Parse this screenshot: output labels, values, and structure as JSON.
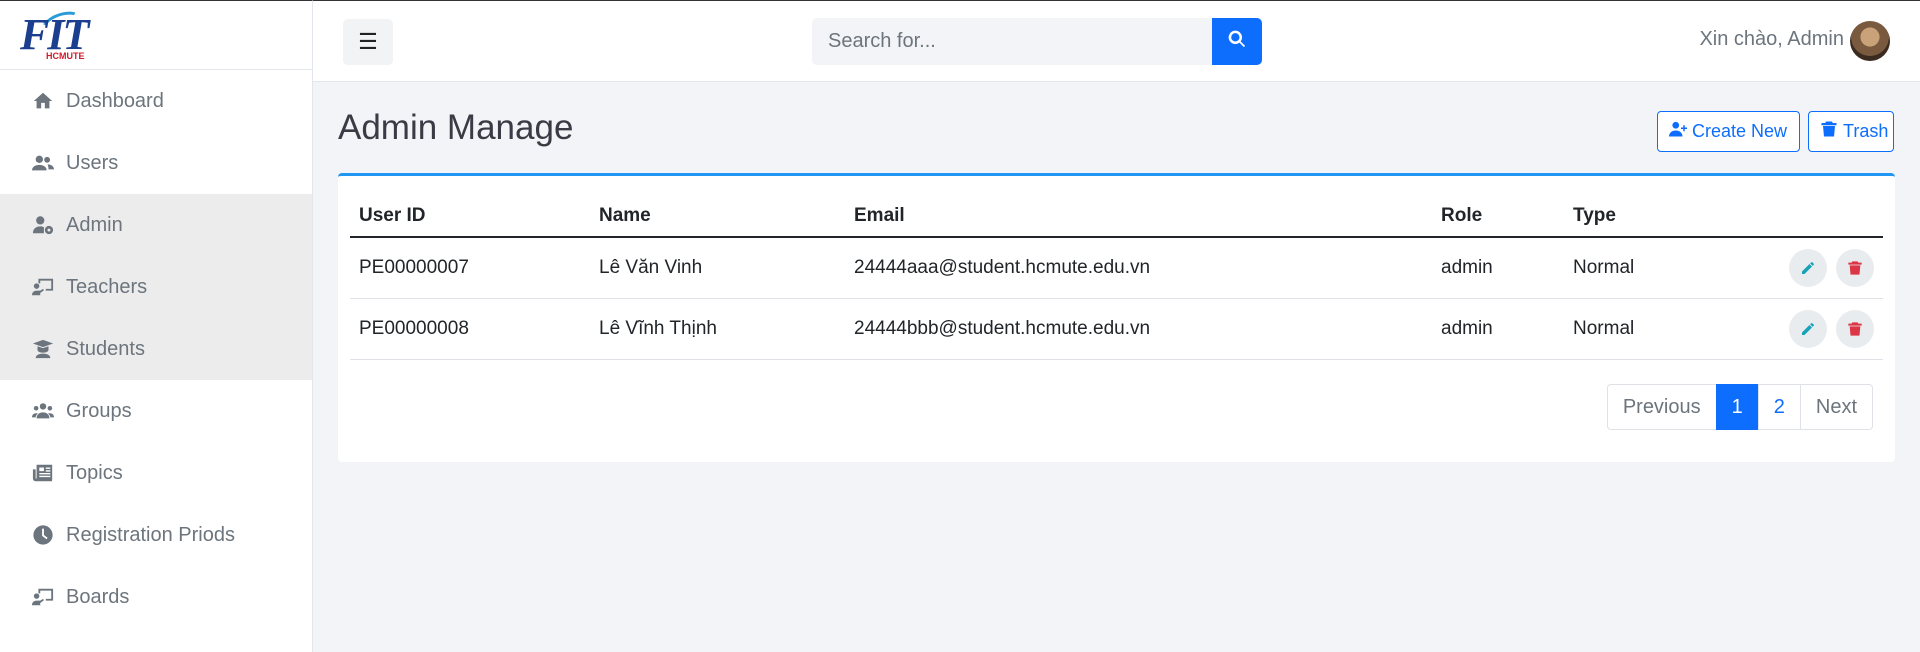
{
  "logo": {
    "text": "FIT",
    "sub": "HCMUTE"
  },
  "sidebar": {
    "items": [
      {
        "label": "Dashboard",
        "icon": "home-icon"
      },
      {
        "label": "Users",
        "icon": "users-icon"
      },
      {
        "label": "Admin",
        "icon": "user-gear-icon",
        "active": true
      },
      {
        "label": "Teachers",
        "icon": "chalkboard-teacher-icon",
        "active": true
      },
      {
        "label": "Students",
        "icon": "graduate-icon",
        "active": true
      },
      {
        "label": "Groups",
        "icon": "group-icon"
      },
      {
        "label": "Topics",
        "icon": "newspaper-icon"
      },
      {
        "label": "Registration Priods",
        "icon": "clock-icon"
      },
      {
        "label": "Boards",
        "icon": "chalkboard-icon"
      }
    ]
  },
  "topbar": {
    "search_placeholder": "Search for...",
    "greeting": "Xin chào, Admin"
  },
  "main": {
    "title": "Admin Manage",
    "create_label": "Create New",
    "trash_label": "Trash",
    "table": {
      "headers": [
        "User ID",
        "Name",
        "Email",
        "Role",
        "Type"
      ],
      "rows": [
        {
          "id": "PE00000007",
          "name": "Lê Văn Vinh",
          "email": "24444aaa@student.hcmute.edu.vn",
          "role": "admin",
          "type": "Normal"
        },
        {
          "id": "PE00000008",
          "name": "Lê Vĩnh Thịnh",
          "email": "24444bbb@student.hcmute.edu.vn",
          "role": "admin",
          "type": "Normal"
        }
      ]
    },
    "pagination": {
      "previous": "Previous",
      "pages": [
        "1",
        "2"
      ],
      "current": "1",
      "next": "Next"
    }
  },
  "colors": {
    "primary": "#0d6efd",
    "accent_border": "#2196f3",
    "edit": "#17a2b8",
    "delete": "#dc3545"
  }
}
